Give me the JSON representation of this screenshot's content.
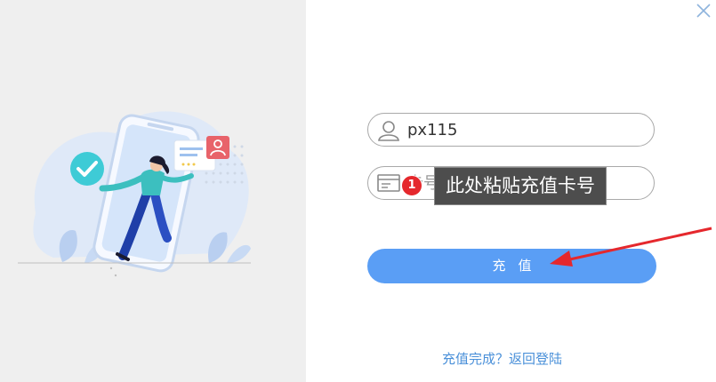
{
  "login_form": {
    "username_value": "px115",
    "card_placeholder": "卡号"
  },
  "annotation": {
    "step_number": "1",
    "tooltip_text": "此处粘贴充值卡号"
  },
  "submit_label": "充值",
  "footer_link_text": "充值完成？返回登陆",
  "colors": {
    "primary": "#5a9ef5",
    "link": "#4a90d9",
    "annotation_red": "#e5282d",
    "left_panel_bg": "#efefef"
  },
  "icons": [
    "close-icon",
    "user-icon",
    "card-icon",
    "checkmark-icon",
    "person-icon"
  ]
}
